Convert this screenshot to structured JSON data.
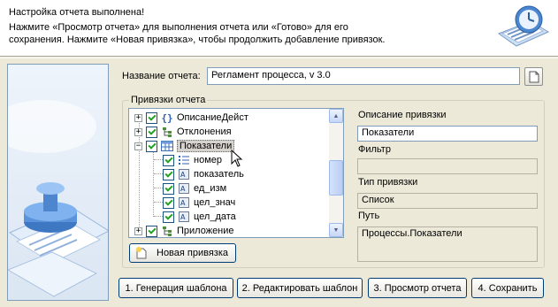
{
  "header": {
    "line1": "Настройка отчета выполнена!",
    "line2": "Нажмите «Просмотр отчета»  для выполнения отчета или «Готово» для его",
    "line3": "сохранения. Нажмите «Новая привязка», чтобы продолжить добавление привязок."
  },
  "report": {
    "label": "Название отчета:",
    "name": "Регламент процесса, v 3.0"
  },
  "bindings": {
    "group_title": "Привязки отчета",
    "tree": [
      {
        "label": "ОписаниеДейст",
        "icon": "braces-icon",
        "expander": "+",
        "checked": true
      },
      {
        "label": "Отклонения",
        "icon": "tree-node-icon",
        "expander": "+",
        "checked": true
      },
      {
        "label": "Показатели",
        "icon": "table-icon",
        "expander": "−",
        "checked": true,
        "selected": true
      },
      {
        "label": "номер",
        "icon": "list-icon",
        "checked": true
      },
      {
        "label": "показатель",
        "icon": "field-icon",
        "checked": true
      },
      {
        "label": "ед_изм",
        "icon": "field-icon",
        "checked": true
      },
      {
        "label": "цел_знач",
        "icon": "field-icon",
        "checked": true
      },
      {
        "label": "цел_дата",
        "icon": "field-icon",
        "checked": true
      },
      {
        "label": "Приложение",
        "icon": "tree-node-icon",
        "expander": "+",
        "checked": true
      }
    ],
    "new_button": "Новая привязка"
  },
  "details": {
    "description_label": "Описание привязки",
    "description_value": "Показатели",
    "filter_label": "Фильтр",
    "filter_value": "",
    "type_label": "Тип привязки",
    "type_value": "Список",
    "path_label": "Путь",
    "path_value": "Процессы.Показатели"
  },
  "buttons": {
    "generate": "1. Генерация шаблона",
    "edit": "2. Редактировать шаблон",
    "preview": "3. Просмотр отчета",
    "save": "4. Сохранить"
  },
  "colors": {
    "window_bg": "#ece9d8",
    "accent": "#316ac5",
    "check": "#21a121"
  }
}
